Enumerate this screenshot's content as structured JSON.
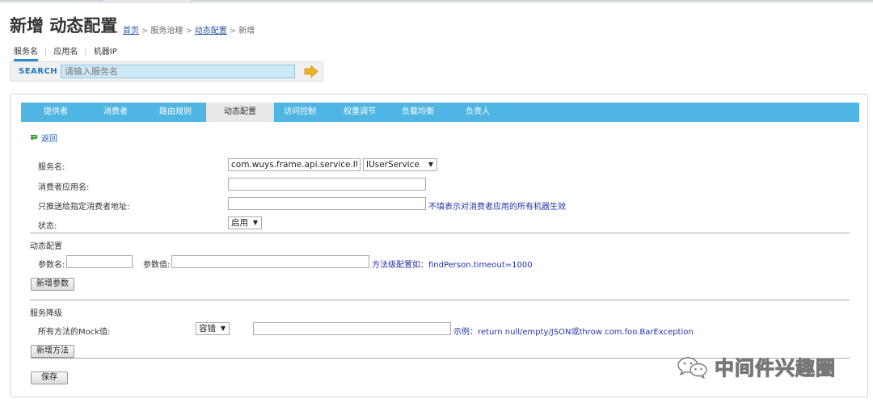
{
  "header": {
    "title": "新增 动态配置",
    "breadcrumb": {
      "home": "首页",
      "sep1": ">",
      "governance": "服务治理",
      "sep2": ">",
      "dynamic_config": "动态配置",
      "sep3": ">",
      "current": "新增"
    }
  },
  "search": {
    "types": [
      "服务名",
      "应用名",
      "机器IP"
    ],
    "type_separator": "|",
    "active_type": "服务名",
    "label": "SEARCH",
    "placeholder": "请输入服务名",
    "value": ""
  },
  "tabs": [
    {
      "label": "提供者",
      "active": false
    },
    {
      "label": "消费者",
      "active": false
    },
    {
      "label": "路由规则",
      "active": false
    },
    {
      "label": "动态配置",
      "active": true
    },
    {
      "label": "访问控制",
      "active": false
    },
    {
      "label": "权重调节",
      "active": false
    },
    {
      "label": "负载均衡",
      "active": false
    },
    {
      "label": "负责人",
      "active": false
    }
  ],
  "back_link": "返回",
  "form": {
    "service_label": "服务名:",
    "service_value": "com.wuys.frame.api.service.IUserService",
    "service_select": "IUserService",
    "consumer_app_label": "消费者应用名:",
    "consumer_app_value": "",
    "consumer_addr_label": "只推送给指定消费者地址:",
    "consumer_addr_value": "",
    "consumer_addr_hint": "不填表示对消费者应用的所有机器生效",
    "status_label": "状态:",
    "status_value": "启用"
  },
  "dynamic_section": {
    "title": "动态配置",
    "param_name_label": "参数名:",
    "param_name_value": "",
    "param_value_label": "参数值:",
    "param_value_value": "",
    "param_hint": "方法级配置如：findPerson.timeout=1000",
    "add_param_button": "新增参数"
  },
  "degrade_section": {
    "title": "服务降级",
    "mock_label": "所有方法的Mock值:",
    "mock_select": "容错",
    "mock_value": "",
    "mock_hint": "示例：return null/empty/JSON或throw com.foo.BarException",
    "add_method_button": "新增方法"
  },
  "save_button": "保存",
  "watermark": "中间件兴趣圈",
  "colors": {
    "tab_bar": "#4fb5e2",
    "link": "#2255aa",
    "hint": "#2233aa",
    "search_label": "#1976c2",
    "back_arrow": "#2e9b2e",
    "search_go_arrow": "#f2b020"
  }
}
